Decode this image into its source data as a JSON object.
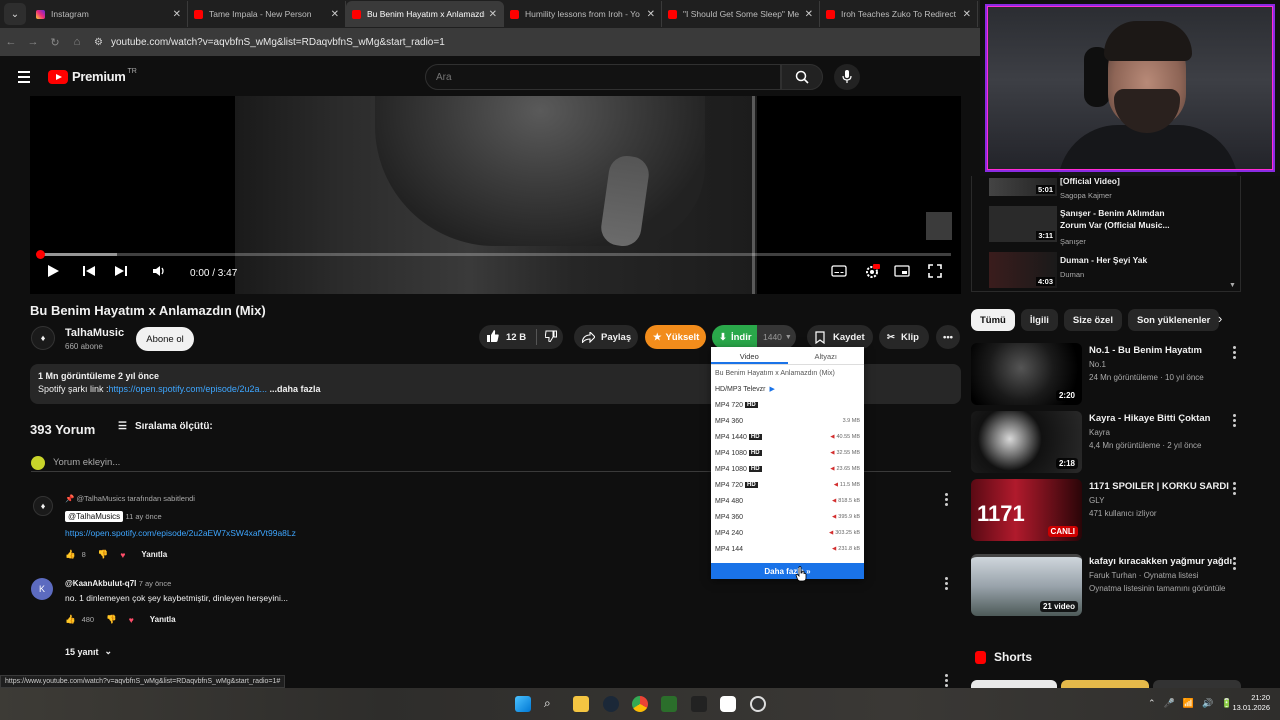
{
  "browser": {
    "tabs": [
      {
        "title": "Instagram",
        "icon": "instagram-icon",
        "active": false
      },
      {
        "title": "Tame Impala - New Person",
        "icon": "youtube-icon",
        "active": false
      },
      {
        "title": "Bu Benim Hayatım x Anlamazdı",
        "icon": "youtube-icon",
        "active": true
      },
      {
        "title": "Humility lessons from Iroh - Yo",
        "icon": "youtube-icon",
        "active": false
      },
      {
        "title": "\"I Should Get Some Sleep\" Me",
        "icon": "youtube-icon",
        "active": false
      },
      {
        "title": "Iroh Teaches Zuko To Redirect L",
        "icon": "youtube-icon",
        "active": false
      }
    ],
    "url": "youtube.com/watch?v=aqvbfnS_wMg&list=RDaqvbfnS_wMg&start_radio=1",
    "status_url": "https://www.youtube.com/watch?v=aqvbfnS_wMg&list=RDaqvbfnS_wMg&start_radio=1#"
  },
  "header": {
    "logo": "Premium",
    "country": "TR",
    "search_placeholder": "Ara"
  },
  "player": {
    "time": "0:00 / 3:47",
    "progress_fraction": 0.0,
    "buffered_fraction": 0.085
  },
  "video": {
    "title": "Bu Benim Hayatım x Anlamazdın (Mix)",
    "channel": "TalhaMusic",
    "subscribers": "660 abone",
    "subscribe_label": "Abone ol",
    "likes": "12 B",
    "share_label": "Paylaş",
    "upgrade_label": "Yükselt",
    "download_label": "İndir",
    "quality_label": "1440",
    "save_label": "Kaydet",
    "clip_label": "Klip"
  },
  "description": {
    "stats": "1 Mn görüntüleme  2 yıl önce",
    "prefix": "Spotify şarkı link :",
    "link": "https://open.spotify.com/episode/2u2a...",
    "more": "...daha fazla"
  },
  "comments": {
    "count": "393 Yorum",
    "sort_label": "Sıralama ölçütü:",
    "add_placeholder": "Yorum ekleyin...",
    "items": [
      {
        "pinned": "@TalhaMusics tarafından sabitlendi",
        "author": "@TalhaMusics",
        "time": "11 ay önce",
        "text": "https://open.spotify.com/episode/2u2aEW7xSW4xafVt99a8Lz",
        "likes": "8",
        "reply_label": "Yanıtla"
      },
      {
        "author": "@KaanAkbulut-q7l",
        "time": "7 ay önce",
        "text": "no. 1 dinlemeyen çok şey kaybetmiştir, dinleyen herşeyini...",
        "likes": "480",
        "reply_label": "Yanıtla",
        "replies": "15 yanıt",
        "avatar_letter": "K"
      }
    ]
  },
  "download_menu": {
    "tabs": [
      "Video",
      "Altyazı"
    ],
    "title": "Bu Benim Hayatım x Anlamazdın (Mix)",
    "rows": [
      {
        "label": "HD/MP3 Televzr",
        "hd": false,
        "size": ""
      },
      {
        "label": "MP4 720",
        "hd": true,
        "size": ""
      },
      {
        "label": "MP4 360",
        "hd": false,
        "size": "3.9 MB"
      },
      {
        "label": "MP4 1440",
        "hd": true,
        "size": "40.55 MB"
      },
      {
        "label": "MP4 1080",
        "hd": true,
        "size": "32.55 MB"
      },
      {
        "label": "MP4 1080",
        "hd": true,
        "size": "23.65 MB"
      },
      {
        "label": "MP4 720",
        "hd": true,
        "size": "11.5 MB"
      },
      {
        "label": "MP4 480",
        "hd": false,
        "size": "818.5 kB"
      },
      {
        "label": "MP4 360",
        "hd": false,
        "size": "395.9 kB"
      },
      {
        "label": "MP4 240",
        "hd": false,
        "size": "303.25 kB"
      },
      {
        "label": "MP4 144",
        "hd": false,
        "size": "231.8 kB"
      }
    ],
    "more_label": "Daha fazla »"
  },
  "playlist": [
    {
      "title": "[Official Video]",
      "artist": "Sagopa Kajmer",
      "duration": "5:01"
    },
    {
      "title": "Şanışer - Benim Aklımdan Zorum Var (Official Music...",
      "artist": "Şanışer",
      "duration": "3:11"
    },
    {
      "title": "Duman - Her Şeyi Yak",
      "artist": "Duman",
      "duration": "4:03"
    }
  ],
  "chips": [
    "Tümü",
    "İlgili",
    "Size özel",
    "Son yüklenenler"
  ],
  "recommendations": [
    {
      "title": "No.1 - Bu Benim Hayatım",
      "channel": "No.1",
      "views": "24 Mn görüntüleme · 10 yıl önce",
      "duration": "2:20"
    },
    {
      "title": "Kayra - Hikaye Bitti Çoktan",
      "channel": "Kayra",
      "views": "4,4 Mn görüntüleme · 2 yıl önce",
      "duration": "2:18"
    },
    {
      "title": "1171 SPOILER | KORKU SARDI",
      "channel": "GLY",
      "views": "471 kullanıcı izliyor",
      "duration": "CANLI"
    },
    {
      "title": "kafayı kıracakken yağmur yağdı",
      "channel": "Faruk Turhan · Oynatma listesi",
      "views": "Oynatma listesinin tamamını görüntüle",
      "duration": "21 video"
    }
  ],
  "shorts_label": "Shorts",
  "taskbar": {
    "time": "21:20",
    "date": "13.01.2026"
  }
}
